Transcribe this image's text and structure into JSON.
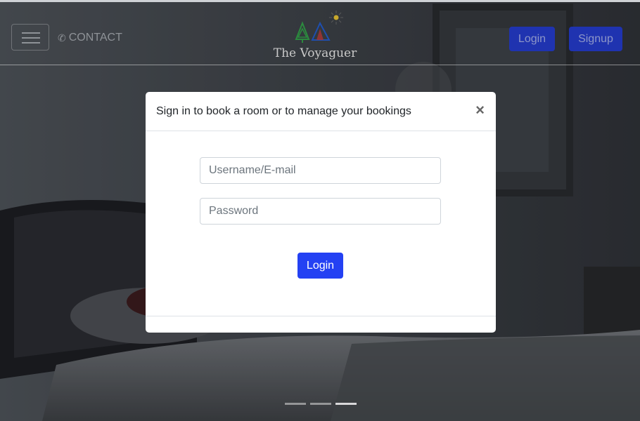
{
  "navbar": {
    "contact_label": "CONTACT",
    "brand_name": "The Voyaguer",
    "login_label": "Login",
    "signup_label": "Signup"
  },
  "modal": {
    "title": "Sign in to book a room or to manage your bookings",
    "close_label": "×",
    "username_placeholder": "Username/E-mail",
    "password_placeholder": "Password",
    "login_label": "Login"
  },
  "carousel": {
    "slide_count": 3,
    "active_index": 2
  },
  "colors": {
    "primary": "#2441f3",
    "nav_button": "#1f33b0",
    "overlay": "#2b2f35"
  },
  "icons": [
    "menu-icon",
    "phone-icon",
    "close-icon",
    "logo-trees-tent-sun"
  ]
}
